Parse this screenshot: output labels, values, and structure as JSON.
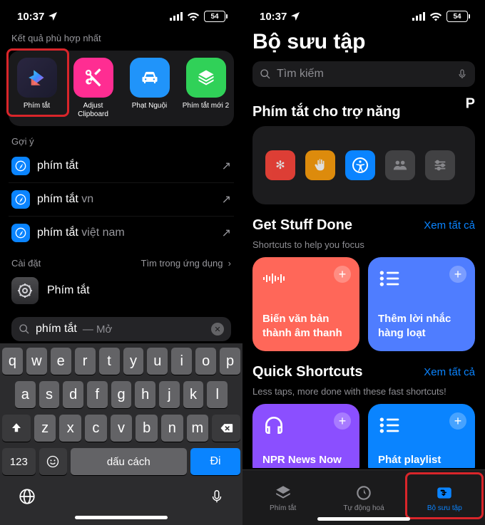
{
  "status": {
    "time": "10:37",
    "battery": "54"
  },
  "left": {
    "results_label": "Kết quả phù hợp nhất",
    "apps": [
      {
        "name": "Phím tắt"
      },
      {
        "name": "Adjust Clipboard"
      },
      {
        "name": "Phạt Nguội"
      },
      {
        "name": "Phím tắt mới 2"
      }
    ],
    "suggestions_label": "Gợi ý",
    "suggestions": [
      {
        "main": "phím tắt",
        "extra": ""
      },
      {
        "main": "phím tắt",
        "extra": " vn"
      },
      {
        "main": "phím tắt",
        "extra": " việt nam"
      }
    ],
    "settings": {
      "label": "Cài đặt",
      "hint": "Tìm trong ứng dụng",
      "item": "Phím tắt"
    },
    "search": {
      "query": "phím tắt",
      "hint": "— Mở"
    },
    "keyboard": {
      "r1": [
        "q",
        "w",
        "e",
        "r",
        "t",
        "y",
        "u",
        "i",
        "o",
        "p"
      ],
      "r2": [
        "a",
        "s",
        "d",
        "f",
        "g",
        "h",
        "j",
        "k",
        "l"
      ],
      "r3": [
        "z",
        "x",
        "c",
        "v",
        "b",
        "n",
        "m"
      ],
      "num": "123",
      "space": "dấu cách",
      "go": "Đi"
    }
  },
  "right": {
    "title": "Bộ sưu tập",
    "search_placeholder": "Tìm kiếm",
    "sec1_title": "Phím tắt cho trợ năng",
    "peek": "P",
    "sec2_title": "Get Stuff Done",
    "sec2_sub": "Shortcuts to help you focus",
    "see_all": "Xem tất cả",
    "cards2": [
      {
        "label": "Biến văn bản thành âm thanh"
      },
      {
        "label": "Thêm lời nhắc hàng loạt"
      }
    ],
    "sec3_title": "Quick Shortcuts",
    "sec3_sub": "Less taps, more done with these fast shortcuts!",
    "cards3": [
      {
        "label": "NPR News Now"
      },
      {
        "label": "Phát playlist"
      }
    ],
    "tabs": [
      {
        "label": "Phím tắt"
      },
      {
        "label": "Tự động hoá"
      },
      {
        "label": "Bộ sưu tập"
      }
    ]
  }
}
